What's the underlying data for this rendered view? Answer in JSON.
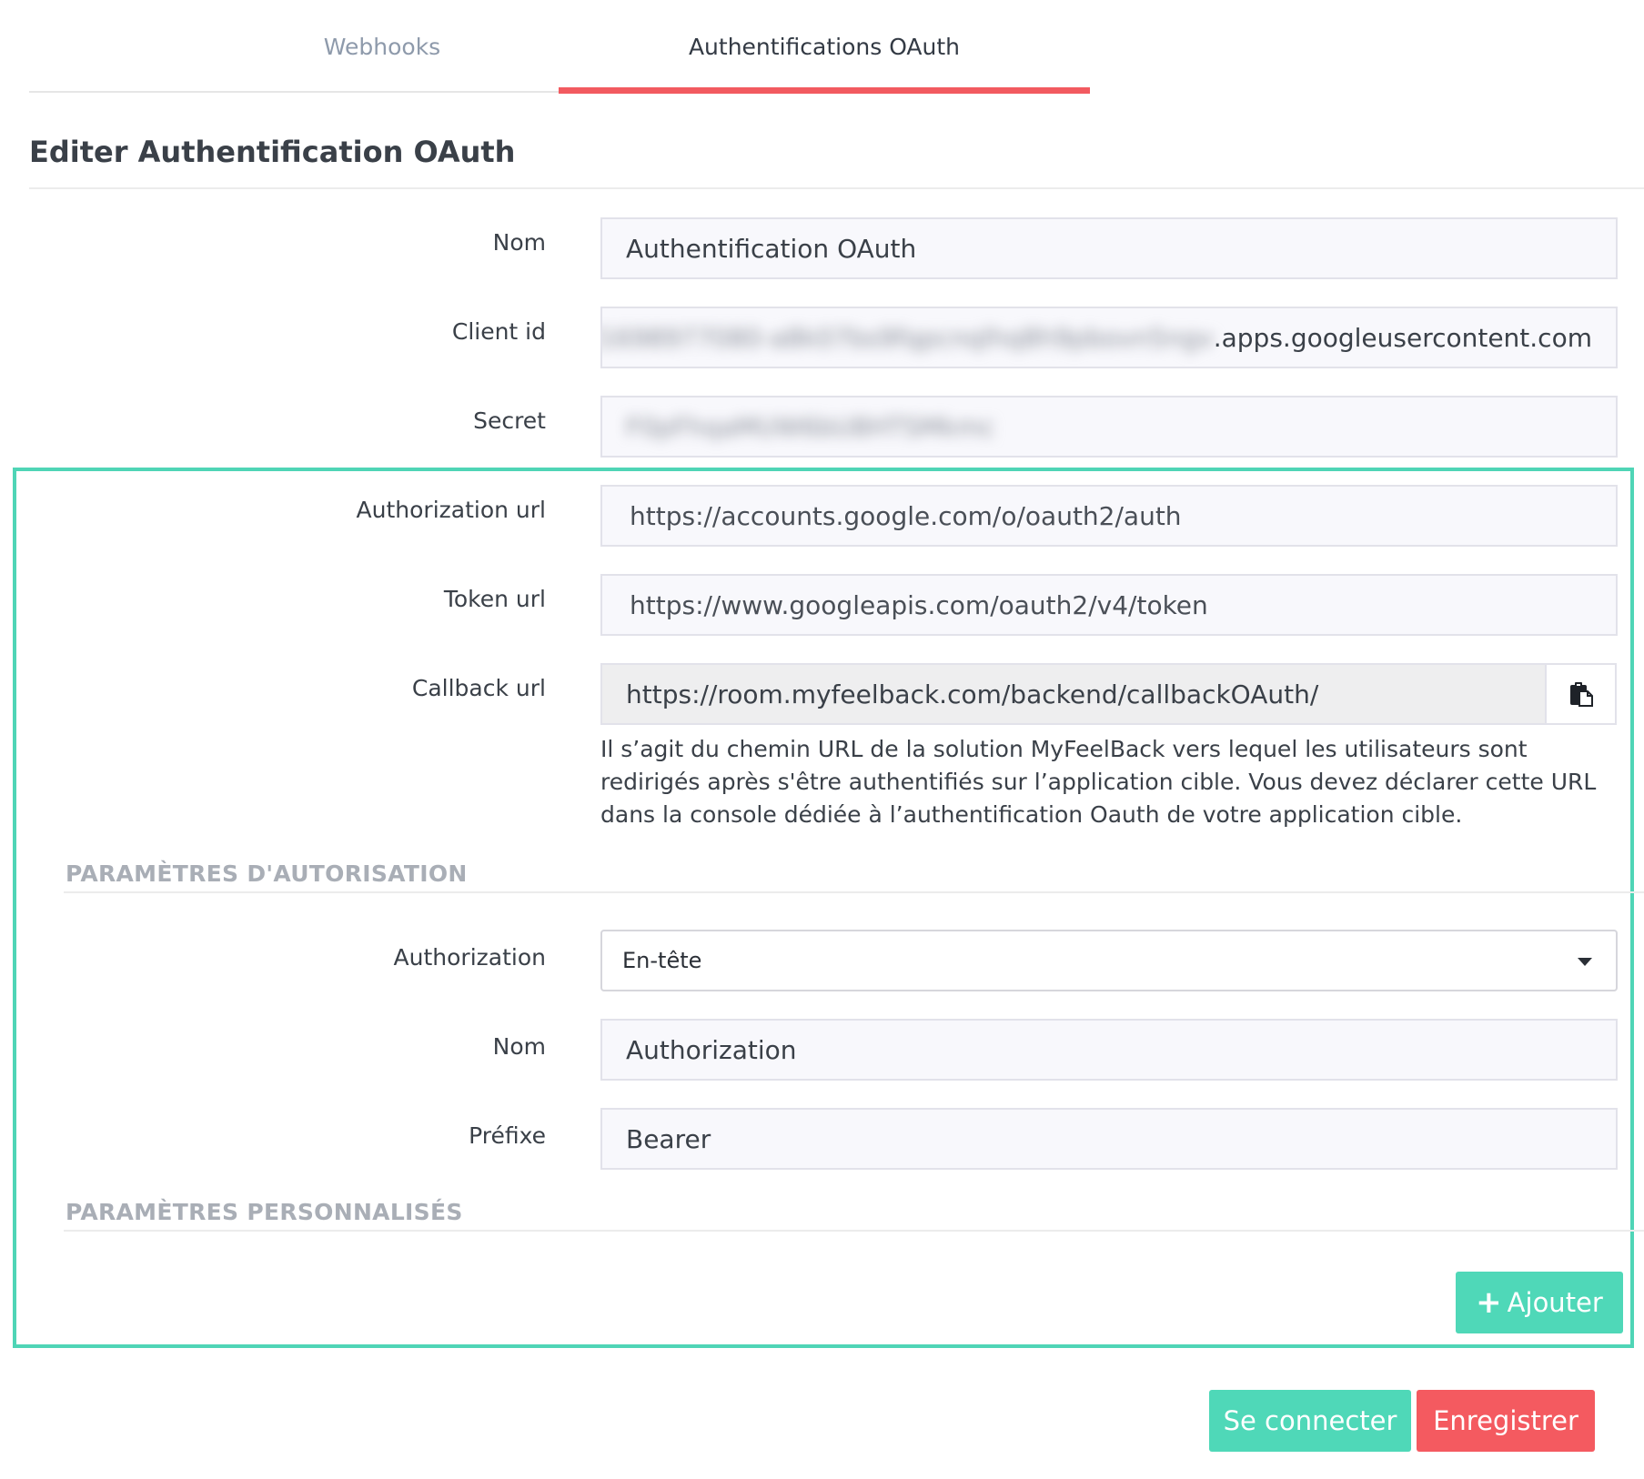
{
  "tabs": [
    {
      "label": "Webhooks"
    },
    {
      "label": "Authentifications OAuth"
    }
  ],
  "page_title": "Editer Authentification OAuth",
  "form": {
    "nom": {
      "label": "Nom",
      "value": "Authentification OAuth"
    },
    "client_id": {
      "label": "Client id",
      "value_hidden": "121698977080-a8k07bs9fqpcnqlhq8h9pbovn5ngv",
      "value_suffix": ".apps.googleusercontent.com"
    },
    "secret": {
      "label": "Secret",
      "value_hidden": "F0pFhqaMUW6bU8HTSMkmc"
    },
    "authorization_url": {
      "label": "Authorization url",
      "value": "https://accounts.google.com/o/oauth2/auth"
    },
    "token_url": {
      "label": "Token url",
      "value": "https://www.googleapis.com/oauth2/v4/token"
    },
    "callback_url": {
      "label": "Callback url",
      "value": "https://room.myfeelback.com/backend/callbackOAuth/"
    },
    "help_text": "Il s’agit du chemin URL de la solution MyFeelBack vers lequel les utilisateurs sont redirigés après s'être authentifiés sur l’application cible. Vous devez déclarer cette URL dans la console dédiée à l’authentification Oauth de votre application cible."
  },
  "auth_params": {
    "heading": "PARAMÈTRES D'AUTORISATION",
    "authorization": {
      "label": "Authorization",
      "selected": "En-tête"
    },
    "nom": {
      "label": "Nom",
      "value": "Authorization"
    },
    "prefixe": {
      "label": "Préfixe",
      "value": "Bearer"
    }
  },
  "custom_params": {
    "heading": "PARAMÈTRES PERSONNALISÉS",
    "add_label": "Ajouter"
  },
  "actions": {
    "connect_label": "Se connecter",
    "save_label": "Enregistrer"
  },
  "colors": {
    "accent_teal": "#4fd8b8",
    "accent_red": "#f45a60",
    "highlight_border": "#4fd5b6"
  }
}
